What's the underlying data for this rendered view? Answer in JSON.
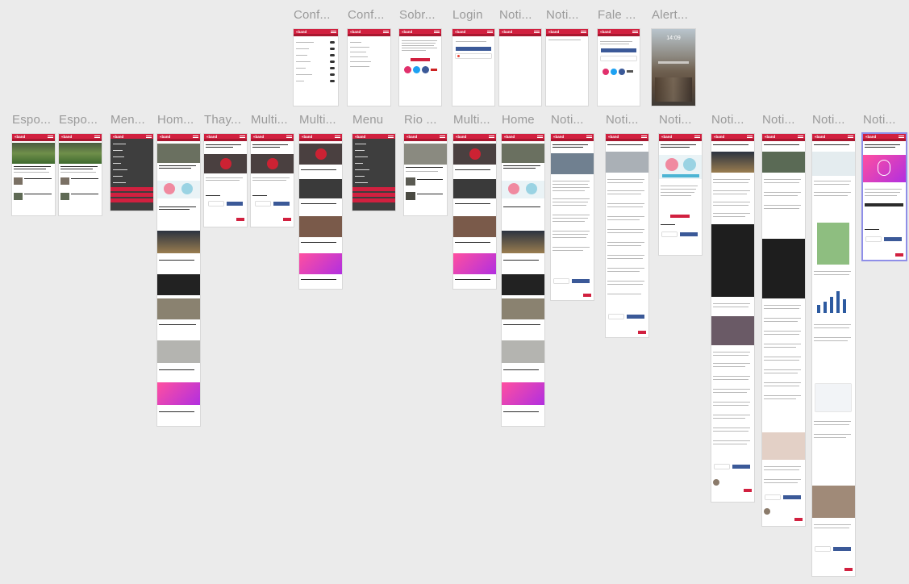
{
  "canvas": {
    "background": "#ebebeb",
    "accent": "#d1203f",
    "selected_outline": "#8f8fe8"
  },
  "artboards_top": [
    {
      "id": "config1",
      "title": "Conf...",
      "kind": "settings"
    },
    {
      "id": "config2",
      "title": "Conf...",
      "kind": "list"
    },
    {
      "id": "sobre",
      "title": "Sobr...",
      "kind": "about"
    },
    {
      "id": "login",
      "title": "Login",
      "kind": "login"
    },
    {
      "id": "noti-a",
      "title": "Noti...",
      "kind": "empty"
    },
    {
      "id": "noti-b",
      "title": "Noti...",
      "kind": "empty"
    },
    {
      "id": "fale",
      "title": "Fale ...",
      "kind": "contact"
    },
    {
      "id": "alert",
      "title": "Alert...",
      "kind": "lockscreen",
      "clock": "14:09"
    }
  ],
  "artboards_bottom": [
    {
      "id": "esp1",
      "title": "Espo...",
      "kind": "sports"
    },
    {
      "id": "esp2",
      "title": "Espo...",
      "kind": "sports"
    },
    {
      "id": "men",
      "title": "Men...",
      "kind": "menu"
    },
    {
      "id": "hom",
      "title": "Hom...",
      "kind": "home-long"
    },
    {
      "id": "thay",
      "title": "Thay...",
      "kind": "article-short"
    },
    {
      "id": "multi1",
      "title": "Multi...",
      "kind": "article-short"
    },
    {
      "id": "multi2",
      "title": "Multi...",
      "kind": "feed"
    },
    {
      "id": "menu",
      "title": "Menu",
      "kind": "menu"
    },
    {
      "id": "rio",
      "title": "Rio ...",
      "kind": "feed-small"
    },
    {
      "id": "multi3",
      "title": "Multi...",
      "kind": "feed"
    },
    {
      "id": "home",
      "title": "Home",
      "kind": "home-long"
    },
    {
      "id": "noti1",
      "title": "Noti...",
      "kind": "article"
    },
    {
      "id": "noti2",
      "title": "Noti...",
      "kind": "article"
    },
    {
      "id": "noti3",
      "title": "Noti...",
      "kind": "article"
    },
    {
      "id": "noti4",
      "title": "Noti...",
      "kind": "article-long"
    },
    {
      "id": "noti5",
      "title": "Noti...",
      "kind": "article-long"
    },
    {
      "id": "noti6",
      "title": "Noti...",
      "kind": "article-long"
    },
    {
      "id": "noti7",
      "title": "Noti...",
      "kind": "article-selected"
    }
  ]
}
